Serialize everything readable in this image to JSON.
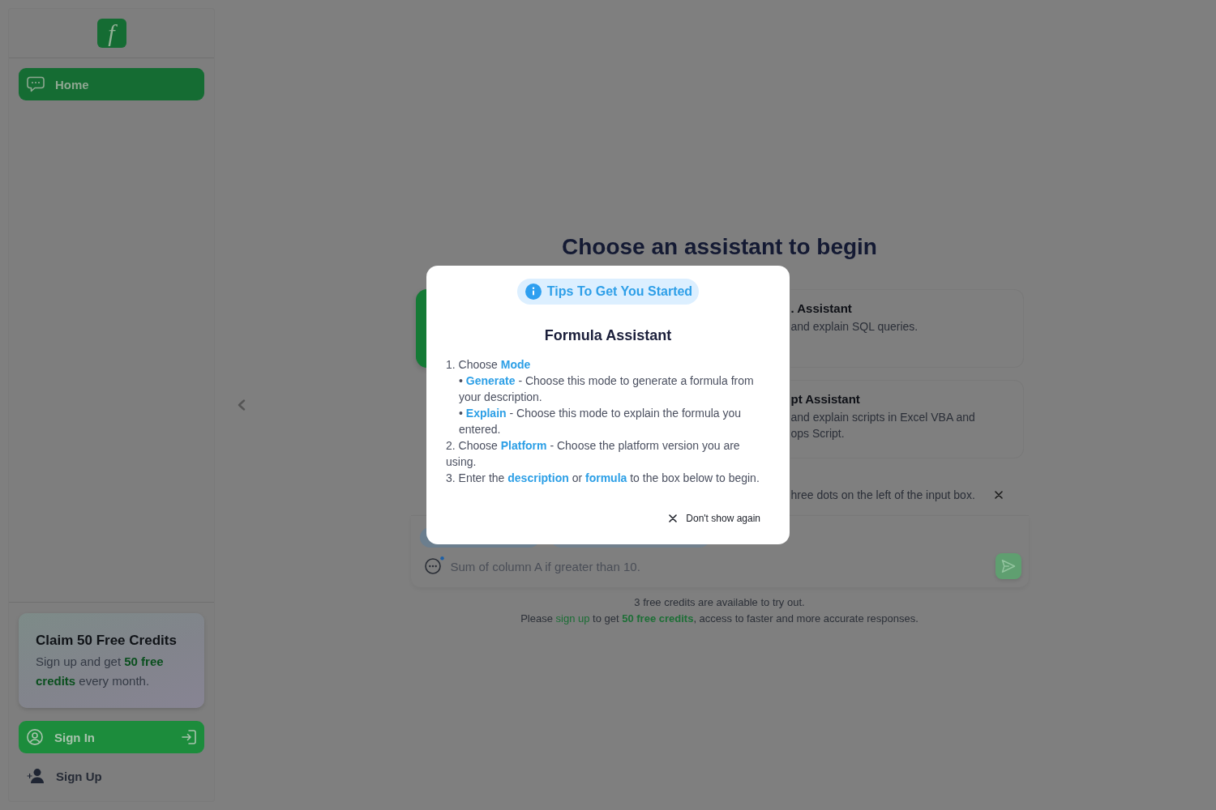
{
  "sidebar": {
    "logo": "f",
    "nav": [
      {
        "label": "Home",
        "selected": true
      }
    ],
    "promo": {
      "title": "Claim 50 Free Credits",
      "text": "Sign up and get **50 free credits** every month."
    },
    "sign_in": "Sign In",
    "sign_up": "Sign Up"
  },
  "main": {
    "heading": "Choose an assistant to begin",
    "assistants": [
      {
        "selected": true
      },
      {
        "title": ". Assistant",
        "description": "and explain SQL queries.",
        "selected": false
      },
      {
        "title": "pt Assistant",
        "description": "and explain scripts in Excel VBA and ops Script.",
        "selected": false
      }
    ],
    "tip": "hree dots on the left of the input box.",
    "prompt": {
      "placeholder": "Sum of column A if greater than 10."
    },
    "credits_note": "3 free credits are available to try out.",
    "signup_note": {
      "before": "Please",
      "link": "sign up",
      "after": "to get **50 free credits**, access to faster and more accurate responses."
    }
  },
  "tips_dialog": {
    "badge": "Tips To Get You Started",
    "title": "Formula Assistant",
    "steps": [
      {
        "text": "1. Choose **Mode**",
        "children": [
          {
            "text": "• **Generate** - Choose this mode to generate a formula from your description."
          },
          {
            "text": "• **Explain** - Choose this mode to explain the formula you entered."
          }
        ]
      },
      {
        "text": "2. Choose **Platform** - Choose the platform version you are using."
      },
      {
        "text": "3. Enter the **description** or **formula** to the box below to begin."
      }
    ],
    "dont_show_again": "Don't show again"
  }
}
